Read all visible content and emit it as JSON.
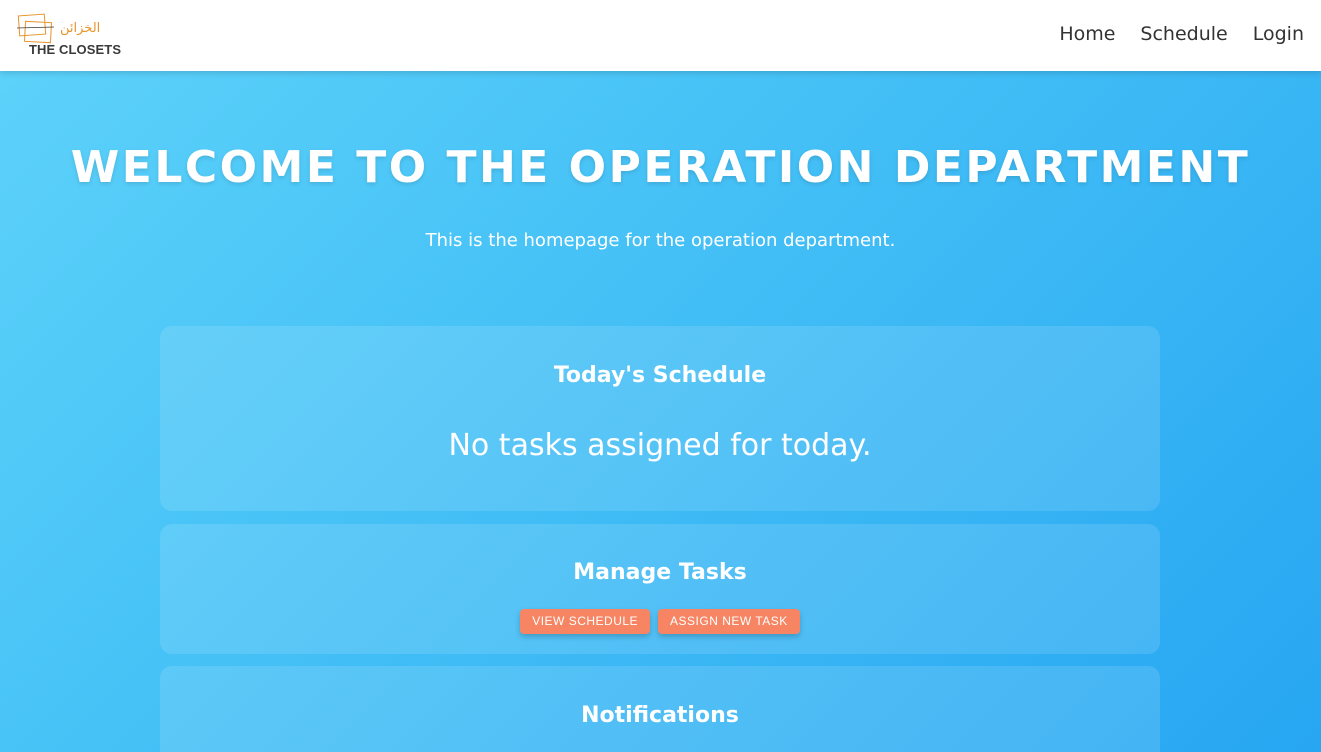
{
  "navbar": {
    "logo_arabic": "الخزائن",
    "logo_text": "THE CLOSETS",
    "links": [
      "Home",
      "Schedule",
      "Login"
    ]
  },
  "hero": {
    "title": "WELCOME TO THE OPERATION DEPARTMENT",
    "subtitle": "This is the homepage for the operation department."
  },
  "schedule_card": {
    "title": "Today's Schedule",
    "message": "No tasks assigned for today."
  },
  "tasks_card": {
    "title": "Manage Tasks",
    "view_schedule_label": "VIEW SCHEDULE",
    "assign_task_label": "ASSIGN NEW TASK"
  },
  "notifications_card": {
    "title": "Notifications"
  },
  "colors": {
    "accent_button": "#f78563",
    "logo_orange": "#e8952b",
    "background_start": "#5ed3fa",
    "background_end": "#27a6f2"
  }
}
